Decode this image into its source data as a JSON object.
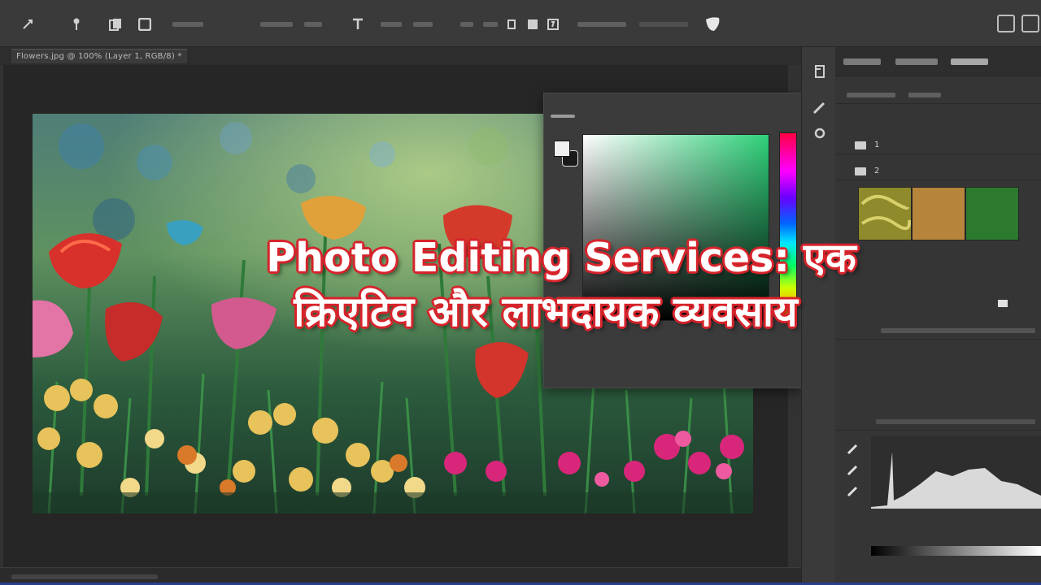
{
  "headline": {
    "line1": "Photo Editing Services: एक",
    "line2": "क्रिएटिव और लाभदायक व्यवसाय"
  },
  "options_bar": {
    "icons": [
      "move-icon",
      "pin-icon",
      "copy-icon",
      "square-icon",
      "text-tool-icon",
      "zoom-icon",
      "stamp-icon"
    ]
  },
  "document_tab": {
    "label": "Flowers.jpg @ 100% (Layer 1, RGB/8) *"
  },
  "color_picker": {
    "fg_color": "#f0f0f0",
    "bg_color": "#1a1a1a",
    "current_hue": "#2fd17a"
  },
  "layers_panel": {
    "rows": [
      {
        "label": "1"
      },
      {
        "label": "2"
      }
    ],
    "thumbnail_colors": [
      "#8f8a2b",
      "#b7843c",
      "#2b7a2e"
    ]
  },
  "colors": {
    "app_bg": "#323232",
    "headline_outline": "#d7232b",
    "bottom_accent": "#2a3f8a"
  }
}
